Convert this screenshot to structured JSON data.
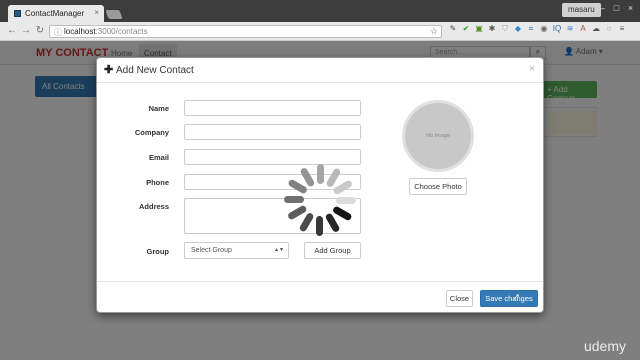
{
  "browser": {
    "tab_title": "ContactManager",
    "tab_close": "×",
    "user": "masaru",
    "window_controls": {
      "minimize": "–",
      "maximize": "□",
      "close": "×"
    },
    "nav": {
      "back": "←",
      "forward": "→",
      "reload": "↻"
    },
    "url_info": "ⓘ",
    "url_host": "localhost",
    "url_path": ":3000/contacts",
    "star": "☆",
    "extensions": [
      {
        "icon": "eyedropper-icon",
        "glyph": "✎",
        "color": "#444"
      },
      {
        "icon": "check-icon",
        "glyph": "✔",
        "color": "#2e9e2e"
      },
      {
        "icon": "counter-icon",
        "glyph": "▣",
        "color": "#5a8a2a"
      },
      {
        "icon": "puzzle-icon",
        "glyph": "✱",
        "color": "#555"
      },
      {
        "icon": "shield-icon",
        "glyph": "⛉",
        "color": "#999"
      },
      {
        "icon": "bookmark-icon",
        "glyph": "◆",
        "color": "#2a8ad9"
      },
      {
        "icon": "frame-icon",
        "glyph": "⌗",
        "color": "#2a6db0"
      },
      {
        "icon": "camera-icon",
        "glyph": "◉",
        "color": "#666"
      },
      {
        "icon": "iq-icon",
        "glyph": "IQ",
        "color": "#2a6db0"
      },
      {
        "icon": "layers-icon",
        "glyph": "≋",
        "color": "#3a7ad0"
      },
      {
        "icon": "text-icon",
        "glyph": "A",
        "color": "#a0522d"
      },
      {
        "icon": "cloud-icon",
        "glyph": "☁",
        "color": "#555"
      },
      {
        "icon": "ring-icon",
        "glyph": "○",
        "color": "#999"
      },
      {
        "icon": "menu-icon",
        "glyph": "≡",
        "color": "#555"
      }
    ]
  },
  "app": {
    "brand": "MY CONTACT",
    "nav_home": "Home",
    "nav_contact": "Contact",
    "search_placeholder": "Search...",
    "search_icon": "⌕",
    "user_menu": "👤 Adam ▾",
    "all_contacts": "All Contacts",
    "add_contact": "+ Add Contact"
  },
  "modal": {
    "plus": "✚",
    "title": "Add New Contact",
    "close": "×",
    "labels": {
      "name": "Name",
      "company": "Company",
      "email": "Email",
      "phone": "Phone",
      "address": "Address",
      "group": "Group"
    },
    "select_group": "Select Group",
    "select_caret": "▲▼",
    "add_group": "Add Group",
    "photo_text": "No Image",
    "choose_photo": "Choose Photo",
    "btn_close": "Close",
    "btn_save": "Save changes"
  },
  "watermark": "udemy",
  "colors": {
    "brand_red": "#c9302c",
    "primary_blue": "#337ab7",
    "success_green": "#5cb85c"
  }
}
